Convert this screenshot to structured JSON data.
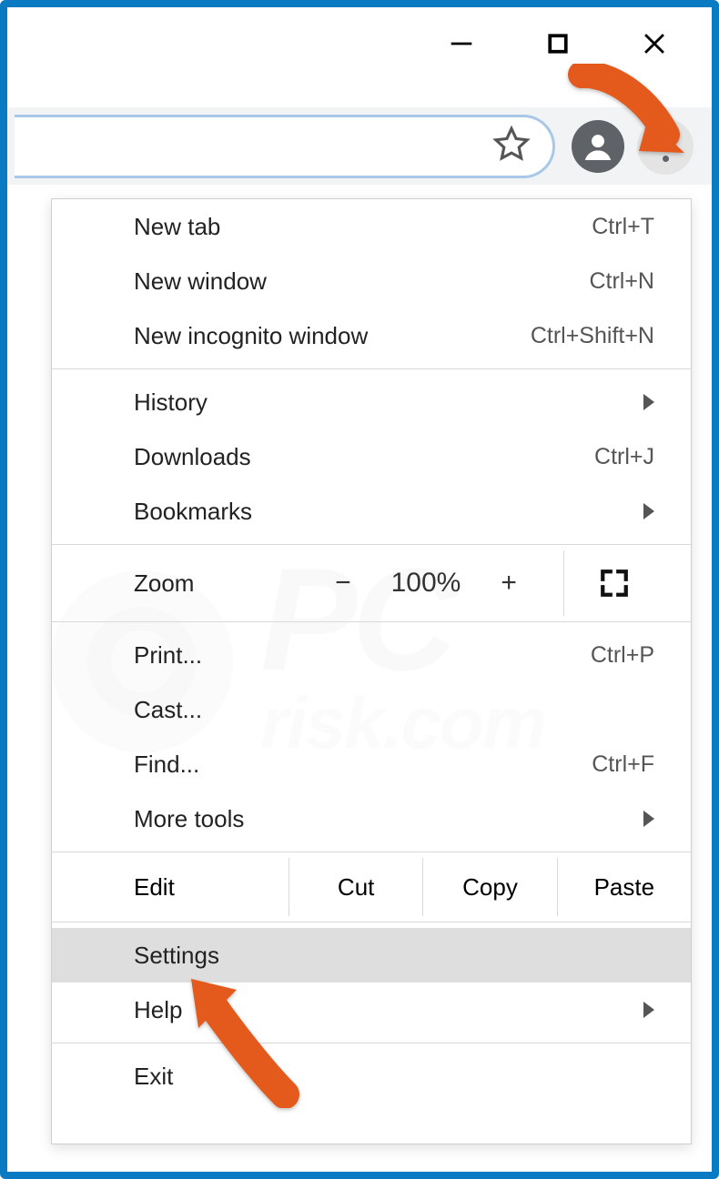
{
  "watermark": {
    "line1": "PC",
    "line2": "risk.com"
  },
  "toolbar": {
    "star_title": "Bookmark",
    "profile_title": "Profile",
    "more_title": "Customize and control Google Chrome"
  },
  "menu": {
    "new_tab": {
      "label": "New tab",
      "shortcut": "Ctrl+T"
    },
    "new_window": {
      "label": "New window",
      "shortcut": "Ctrl+N"
    },
    "new_incognito": {
      "label": "New incognito window",
      "shortcut": "Ctrl+Shift+N"
    },
    "history": {
      "label": "History"
    },
    "downloads": {
      "label": "Downloads",
      "shortcut": "Ctrl+J"
    },
    "bookmarks": {
      "label": "Bookmarks"
    },
    "zoom": {
      "label": "Zoom",
      "minus": "−",
      "value": "100%",
      "plus": "+"
    },
    "print": {
      "label": "Print...",
      "shortcut": "Ctrl+P"
    },
    "cast": {
      "label": "Cast..."
    },
    "find": {
      "label": "Find...",
      "shortcut": "Ctrl+F"
    },
    "more_tools": {
      "label": "More tools"
    },
    "edit": {
      "label": "Edit",
      "cut": "Cut",
      "copy": "Copy",
      "paste": "Paste"
    },
    "settings": {
      "label": "Settings"
    },
    "help": {
      "label": "Help"
    },
    "exit": {
      "label": "Exit"
    }
  }
}
